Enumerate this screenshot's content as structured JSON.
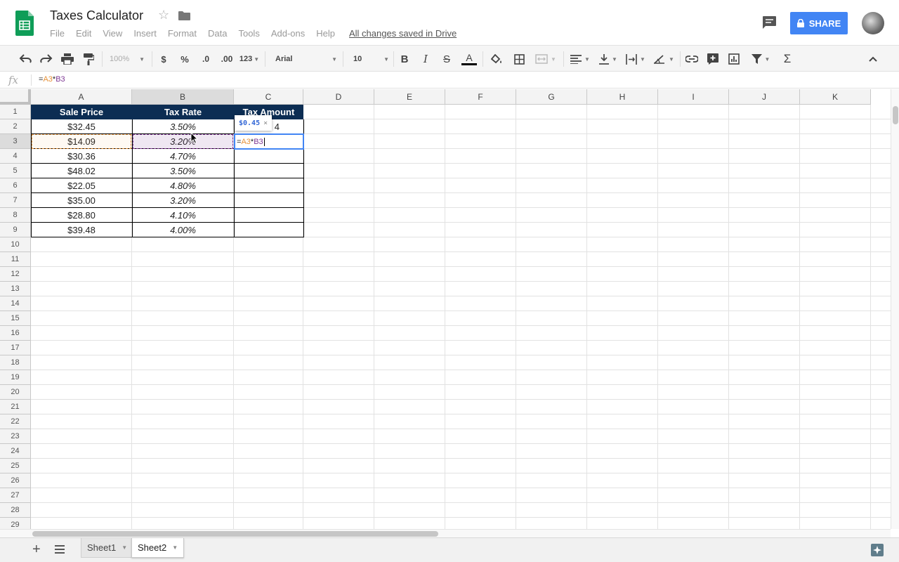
{
  "app": {
    "title": "Taxes Calculator",
    "menus": [
      "File",
      "Edit",
      "View",
      "Insert",
      "Format",
      "Data",
      "Tools",
      "Add-ons",
      "Help"
    ],
    "save_status": "All changes saved in Drive",
    "share_label": "SHARE",
    "accent_color": "#4285f4",
    "logo_color": "#0f9d58"
  },
  "toolbar": {
    "zoom": "100%",
    "currency": "$",
    "percent": "%",
    "decimal_decrease": ".0",
    "decimal_increase": ".00",
    "number_format": "123",
    "font": "Arial",
    "font_size": "10",
    "bold": "B",
    "italic": "I",
    "strikethrough": "S",
    "text_color": "A",
    "sum": "Σ"
  },
  "formula_bar": {
    "fx": "fx",
    "eq": "=",
    "ref_a": "A3",
    "op": "*",
    "ref_b": "B3"
  },
  "grid": {
    "columns": [
      "A",
      "B",
      "C",
      "D",
      "E",
      "F",
      "G",
      "H",
      "I",
      "J",
      "K"
    ],
    "rows": [
      "1",
      "2",
      "3",
      "4",
      "5",
      "6",
      "7",
      "8",
      "9",
      "10",
      "11",
      "12",
      "13",
      "14",
      "15",
      "16",
      "17",
      "18",
      "19",
      "20",
      "21",
      "22",
      "23",
      "24",
      "25",
      "26",
      "27",
      "28",
      "29"
    ],
    "table_headers": [
      "Sale Price",
      "Tax Rate",
      "Tax Amount"
    ],
    "table_header_color": "#0c2d53",
    "sale_prices": [
      "$32.45",
      "$14.09",
      "$30.36",
      "$48.02",
      "$22.05",
      "$35.00",
      "$28.80",
      "$39.48"
    ],
    "tax_rates": [
      "3.50%",
      "3.20%",
      "4.70%",
      "3.50%",
      "4.80%",
      "3.20%",
      "4.10%",
      "4.00%"
    ],
    "c2_partial": "4",
    "edit_cell": {
      "eq": "=",
      "ref_a": "A3",
      "op": "*",
      "ref_b": "B3"
    },
    "preview_tooltip": {
      "value": "$0.45",
      "close": "×"
    }
  },
  "sheets": [
    {
      "name": "Sheet1",
      "active": false
    },
    {
      "name": "Sheet2",
      "active": true
    }
  ]
}
